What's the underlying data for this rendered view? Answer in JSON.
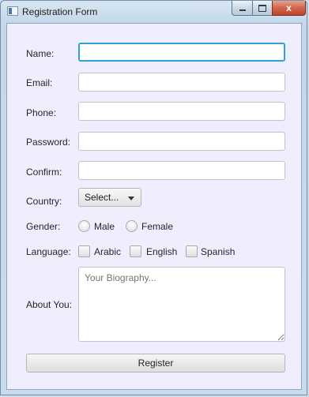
{
  "window": {
    "title": "Registration Form",
    "close_glyph": "x"
  },
  "form": {
    "name_label": "Name:",
    "email_label": "Email:",
    "phone_label": "Phone:",
    "password_label": "Password:",
    "confirm_label": "Confirm:",
    "country_label": "Country:",
    "country_selected": "Select...",
    "gender_label": "Gender:",
    "gender_options": [
      "Male",
      "Female"
    ],
    "language_label": "Language:",
    "language_options": [
      "Arabic",
      "English",
      "Spanish"
    ],
    "about_label": "About You:",
    "about_placeholder": "Your Biography...",
    "register_label": "Register",
    "name_value": "",
    "email_value": "",
    "phone_value": "",
    "password_value": "",
    "confirm_value": ""
  },
  "colors": {
    "client_bg": "#efeeff",
    "focus_border": "#2f9fd6",
    "close_button": "#c0432a"
  }
}
